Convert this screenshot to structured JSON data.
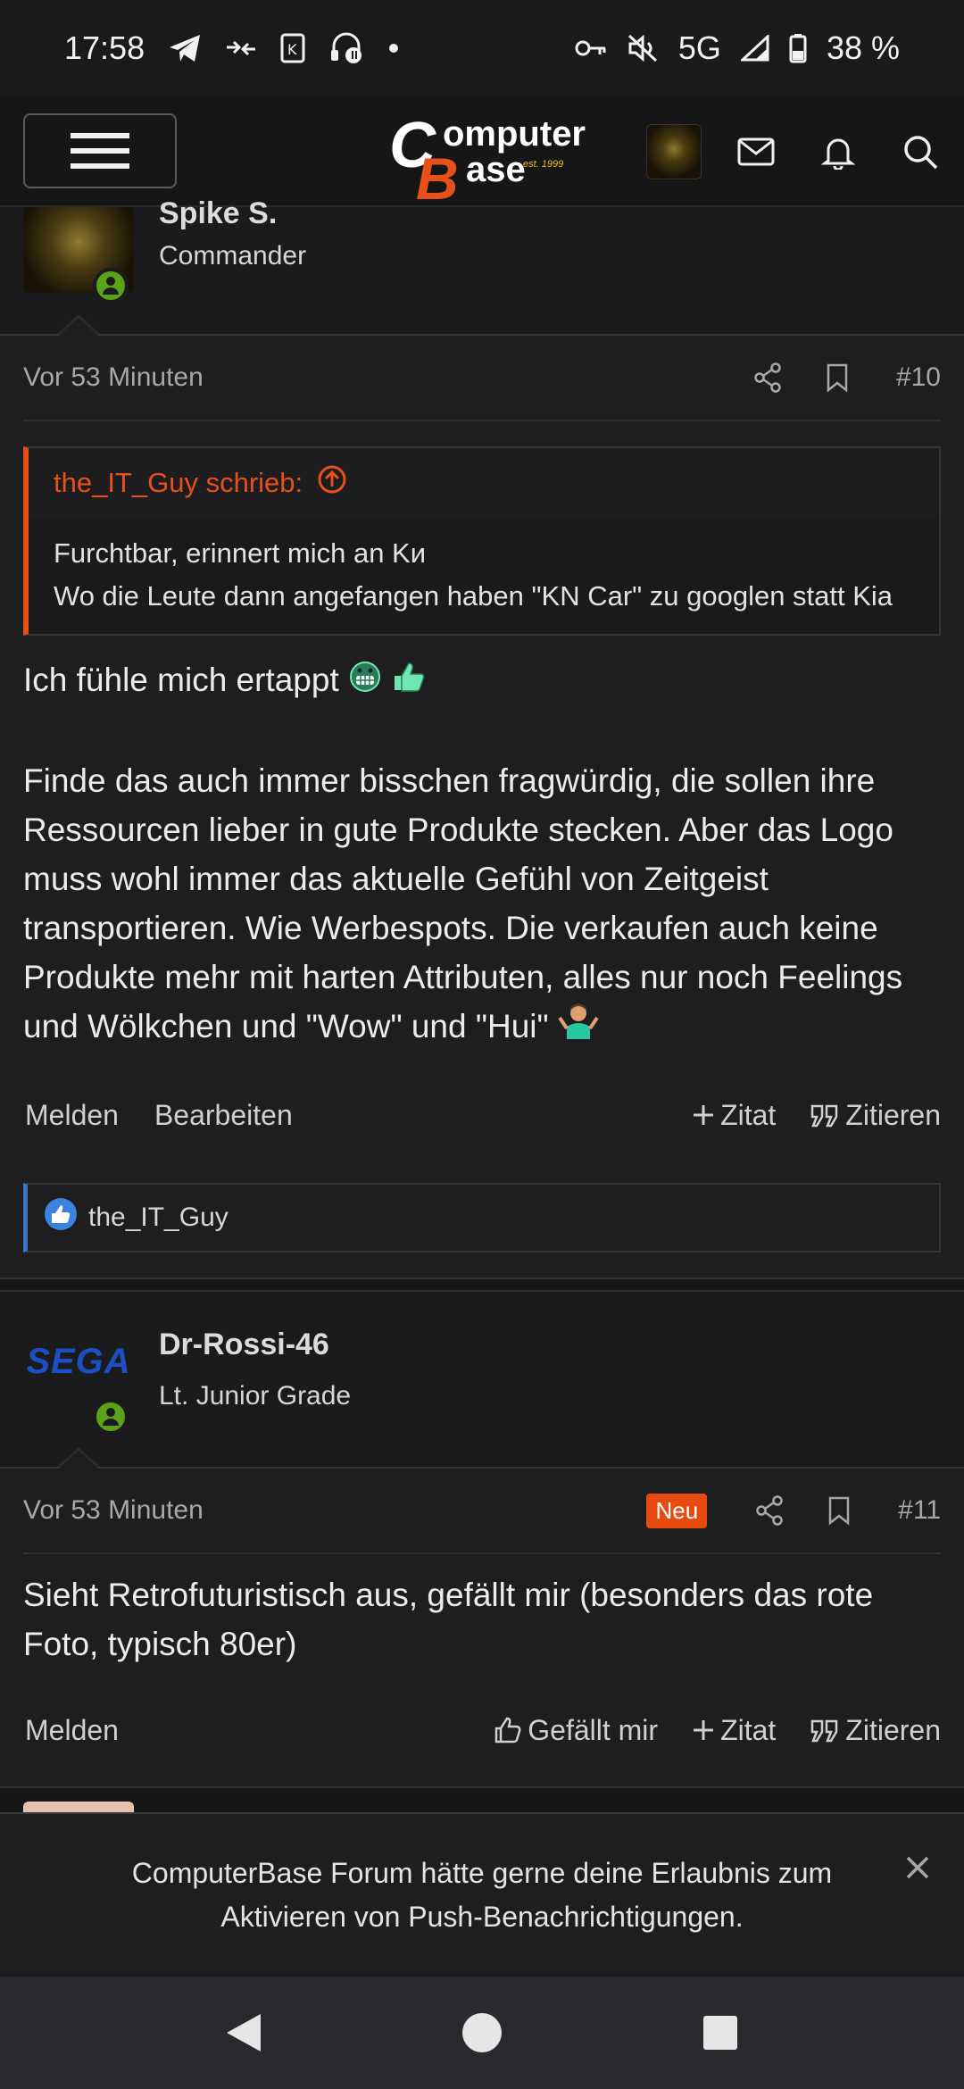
{
  "status_bar": {
    "time": "17:58",
    "network": "5G",
    "battery": "38 %",
    "icons_left": [
      "telegram-icon",
      "swap-icon",
      "k-app-icon",
      "headset-icon",
      "dot-icon"
    ],
    "icons_right": [
      "vpn-key-icon",
      "mute-icon",
      "signal-icon",
      "battery-icon"
    ]
  },
  "header": {
    "logo": {
      "line1": "omputer",
      "line2": "ase",
      "c": "C",
      "b": "B",
      "est": "est. 1999"
    }
  },
  "posts": [
    {
      "author": "Spike S.",
      "user_title": "Commander",
      "time": "Vor 53 Minuten",
      "number": "#10",
      "quote": {
        "author": "the_IT_Guy schrieb:",
        "lines": [
          "Furchtbar, erinnert mich an Kи",
          "Wo die Leute dann angefangen haben \"KN Car\" zu googlen statt Kia"
        ]
      },
      "paragraphs": [
        "Ich fühle mich ertappt",
        "Finde das auch immer bisschen fragwürdig, die sollen ihre Ressourcen lieber in gute Produkte stecken. Aber das Logo muss wohl immer das aktuelle Gefühl von Zeitgeist transportieren. Wie Werbespots. Die verkaufen auch keine Produkte mehr mit harten Attributen, alles nur noch Feelings und Wölkchen und \"Wow\" und \"Hui\""
      ],
      "actions": {
        "report": "Melden",
        "edit": "Bearbeiten",
        "multiquote": "Zitat",
        "quote": "Zitieren"
      },
      "likes": "the_IT_Guy"
    },
    {
      "author": "Dr-Rossi-46",
      "user_title": "Lt. Junior Grade",
      "avatar_text": "SEGA",
      "time": "Vor 53 Minuten",
      "badge": "Neu",
      "number": "#11",
      "paragraphs": [
        "Sieht Retrofuturistisch aus, gefällt mir (besonders das rote Foto, typisch 80er)"
      ],
      "actions": {
        "report": "Melden",
        "like": "Gefällt mir",
        "multiquote": "Zitat",
        "quote": "Zitieren"
      }
    }
  ],
  "notification": {
    "text": "ComputerBase Forum hätte gerne deine Erlaubnis zum Aktivieren von Push-Benachrichtigungen."
  },
  "colors": {
    "accent": "#e8501a",
    "online": "#5aa318",
    "like_blue": "#3a74c8",
    "badge_new": "#e84a10"
  }
}
